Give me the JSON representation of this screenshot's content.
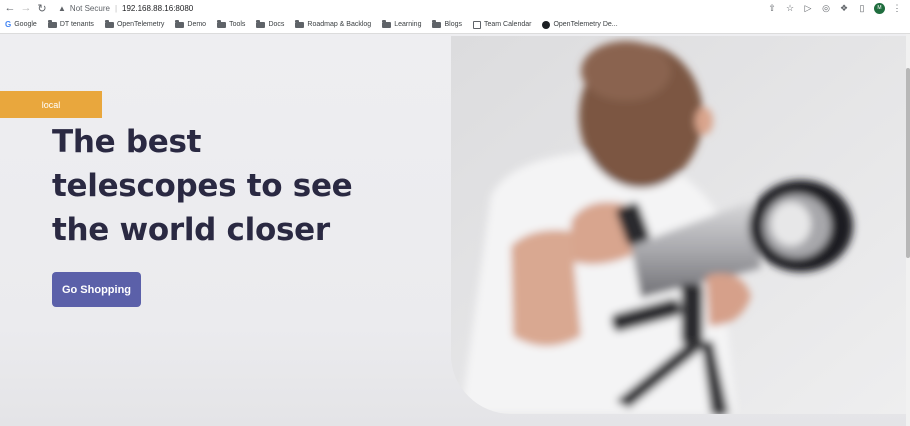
{
  "browser": {
    "security_label": "Not Secure",
    "url": "192.168.88.16:8080",
    "profile_initials": "M"
  },
  "bookmarks": [
    {
      "label": "Google",
      "icon": "google-icon"
    },
    {
      "label": "DT tenants",
      "icon": "folder-icon"
    },
    {
      "label": "OpenTelemetry",
      "icon": "folder-icon"
    },
    {
      "label": "Demo",
      "icon": "folder-icon"
    },
    {
      "label": "Tools",
      "icon": "folder-icon"
    },
    {
      "label": "Docs",
      "icon": "folder-icon"
    },
    {
      "label": "Roadmap & Backlog",
      "icon": "folder-icon"
    },
    {
      "label": "Learning",
      "icon": "folder-icon"
    },
    {
      "label": "Blogs",
      "icon": "folder-icon"
    },
    {
      "label": "Team Calendar",
      "icon": "calendar-icon"
    },
    {
      "label": "OpenTelemetry De...",
      "icon": "github-icon"
    }
  ],
  "hero": {
    "badge": "local",
    "headline_lines": [
      "The best",
      "telescopes to see",
      "the world closer"
    ],
    "cta_label": "Go Shopping"
  },
  "colors": {
    "badge": "#e9a73d",
    "headline": "#2a2942",
    "cta": "#5b60a9",
    "background": "#ececef"
  }
}
